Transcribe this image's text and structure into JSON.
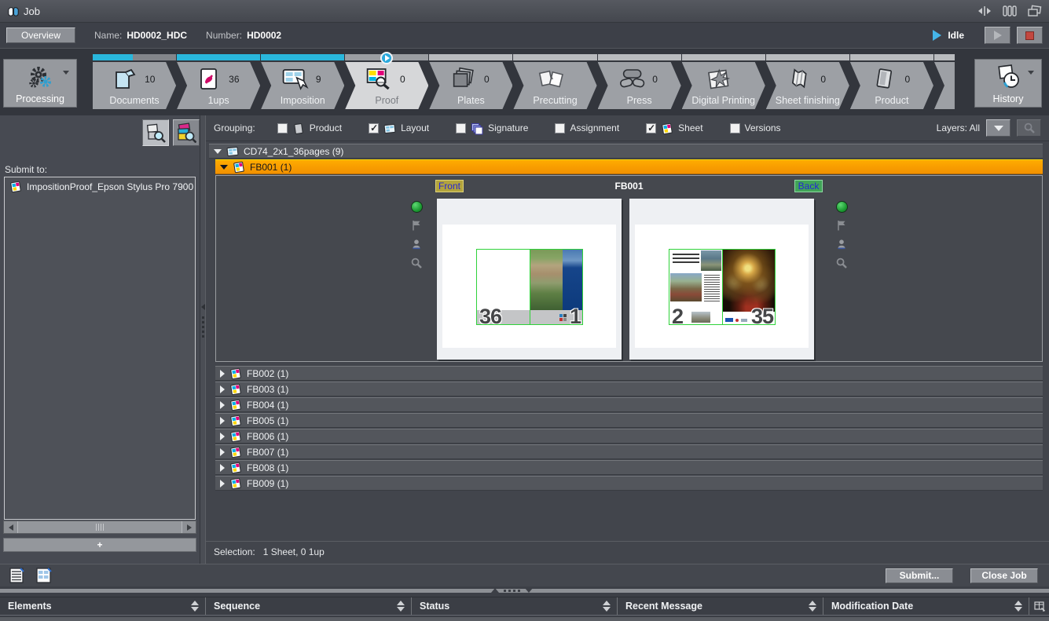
{
  "titlebar": {
    "title": "Job"
  },
  "jobbar": {
    "overview": "Overview",
    "name_label": "Name:",
    "name": "HD0002_HDC",
    "number_label": "Number:",
    "number": "HD0002",
    "status": "Idle"
  },
  "workflow": {
    "processing": "Processing",
    "history": "History",
    "steps": [
      {
        "label": "Documents",
        "count": "10",
        "icon": "documents",
        "progress": "half"
      },
      {
        "label": "1ups",
        "count": "36",
        "icon": "pdf",
        "progress": "done"
      },
      {
        "label": "Imposition",
        "count": "9",
        "icon": "imposition",
        "progress": "done"
      },
      {
        "label": "Proof",
        "count": "0",
        "icon": "proof",
        "progress": "wait",
        "state": "active",
        "badge": true
      },
      {
        "label": "Plates",
        "count": "0",
        "icon": "plates",
        "progress": "far"
      },
      {
        "label": "Precutting",
        "count": "",
        "icon": "precutting",
        "progress": "far"
      },
      {
        "label": "Press",
        "count": "0",
        "icon": "press",
        "progress": "far"
      },
      {
        "label": "Digital Printing",
        "count": "",
        "icon": "digital",
        "progress": "far"
      },
      {
        "label": "Sheet finishing",
        "count": "0",
        "icon": "finishing",
        "progress": "far"
      },
      {
        "label": "Product",
        "count": "0",
        "icon": "product",
        "progress": "far"
      }
    ]
  },
  "sidebar": {
    "submit_to": "Submit to:",
    "printer": "ImpositionProof_Epson Stylus Pro 7900",
    "add": "+"
  },
  "grouping": {
    "label": "Grouping:",
    "options": [
      {
        "label": "Product",
        "icon": "page",
        "checked": false
      },
      {
        "label": "Layout",
        "icon": "layout",
        "checked": true
      },
      {
        "label": "Signature",
        "icon": "signature",
        "checked": false
      },
      {
        "label": "Assignment",
        "icon": "",
        "checked": false
      },
      {
        "label": "Sheet",
        "icon": "cmyk",
        "checked": true
      },
      {
        "label": "Versions",
        "icon": "",
        "checked": false
      }
    ],
    "layers": "Layers: All"
  },
  "tree": {
    "layout": "CD74_2x1_36pages (9)",
    "selected": "FB001 (1)",
    "preview": {
      "front": "Front",
      "back": "Back",
      "title": "FB001",
      "front_left_page": "36",
      "front_right_page": "1",
      "back_left_page": "2",
      "back_right_page": "35"
    },
    "sheets": [
      "FB002 (1)",
      "FB003 (1)",
      "FB004 (1)",
      "FB005 (1)",
      "FB006 (1)",
      "FB007 (1)",
      "FB008 (1)",
      "FB009 (1)"
    ]
  },
  "selection": {
    "label": "Selection:",
    "value": "1 Sheet,  0 1up"
  },
  "footer": {
    "submit": "Submit...",
    "close_job": "Close Job"
  },
  "table": {
    "columns": [
      {
        "label": "Elements"
      },
      {
        "label": "Sequence"
      },
      {
        "label": "Status"
      },
      {
        "label": "Recent Message"
      },
      {
        "label": "Modification Date"
      }
    ]
  },
  "colors": {
    "accent_cyan": "#29b7dc",
    "selection_orange": "#f59b00",
    "page_border_green": "#2fd23a",
    "status_green": "#1d9c33",
    "front_badge": "#b3a43c",
    "back_badge": "#41a458"
  }
}
